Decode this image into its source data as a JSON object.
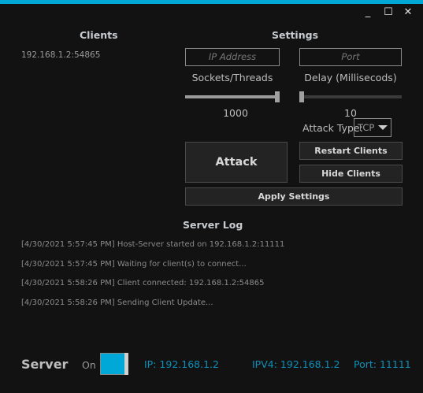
{
  "window": {
    "minimize": "_",
    "maximize": "☐",
    "close": "✕",
    "accent": "#00a8d8"
  },
  "clients": {
    "title": "Clients",
    "items": [
      "192.168.1.2:54865"
    ]
  },
  "settings": {
    "title": "Settings",
    "ip_placeholder": "IP Address",
    "port_placeholder": "Port",
    "sockets_label": "Sockets/Threads",
    "delay_label": "Delay (Millisecods)",
    "sockets_value": "1000",
    "sockets_fraction": 1.0,
    "delay_value": "10",
    "delay_fraction": 0.0,
    "attack_type_label": "Attack Type:",
    "attack_type_value": "TCP"
  },
  "buttons": {
    "attack": "Attack",
    "restart": "Restart Clients",
    "hide": "Hide Clients",
    "apply": "Apply Settings"
  },
  "log": {
    "title": "Server Log",
    "lines": [
      "[4/30/2021 5:57:45 PM] Host-Server started on 192.168.1.2:11111",
      "[4/30/2021 5:57:45 PM] Waiting for client(s) to connect...",
      "[4/30/2021 5:58:26 PM] Client connected: 192.168.1.2:54865",
      "[4/30/2021 5:58:26 PM] Sending Client Update..."
    ]
  },
  "status": {
    "title": "Server",
    "toggle_label": "On",
    "toggle_on": true,
    "ip": "IP: 192.168.1.2",
    "ipv4": "IPV4: 192.168.1.2",
    "port": "Port: 11111"
  }
}
